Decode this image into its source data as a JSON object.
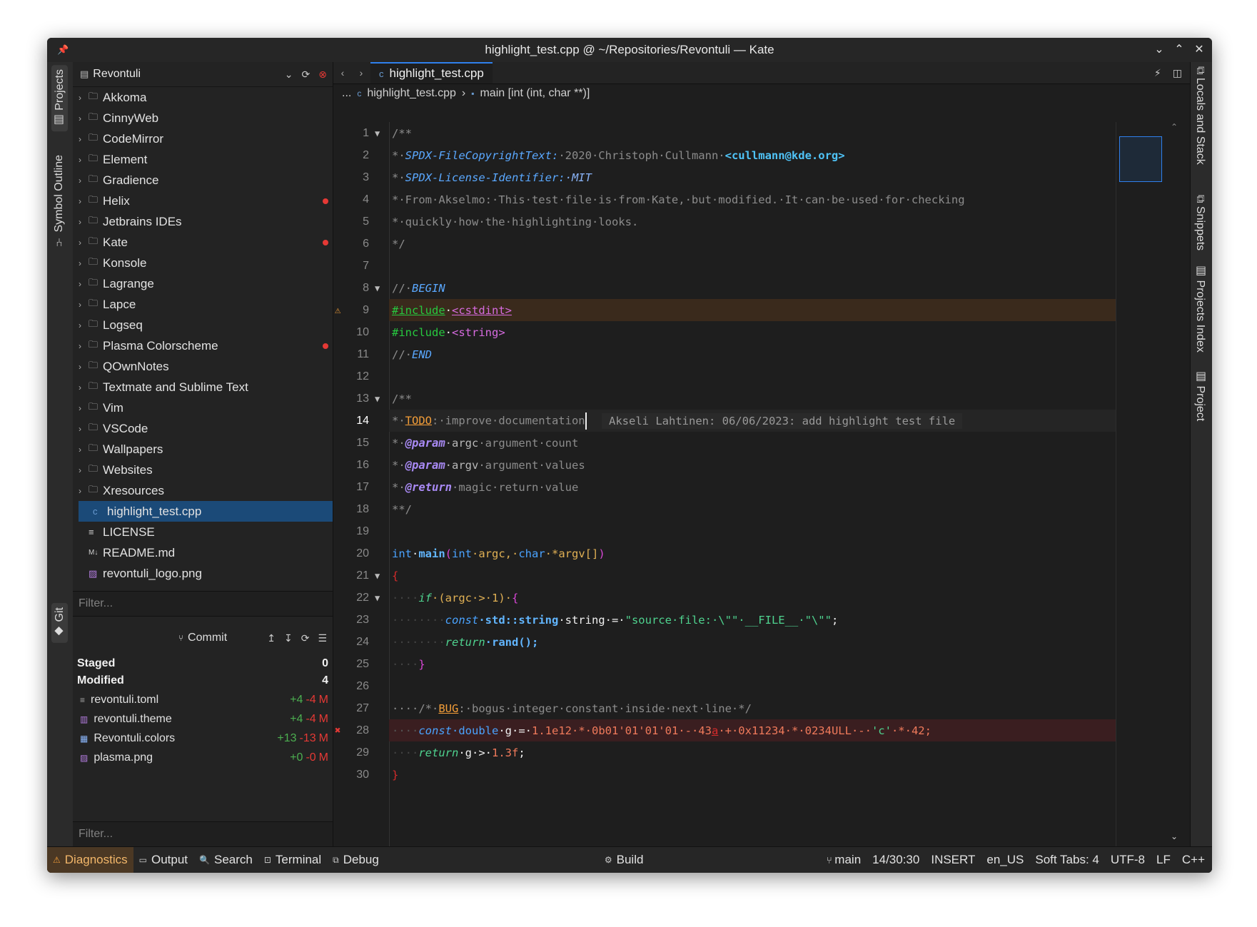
{
  "window": {
    "title": "highlight_test.cpp @ ~/Repositories/Revontuli — Kate"
  },
  "left_tabs": {
    "projects": "Projects",
    "symbol_outline": "Symbol Outline",
    "git": "Git"
  },
  "right_tabs": {
    "locals": "Locals and Stack",
    "snippets": "Snippets",
    "projects_index": "Projects Index",
    "project": "Project"
  },
  "project": {
    "name": "Revontuli",
    "folders": [
      "Akkoma",
      "CinnyWeb",
      "CodeMirror",
      "Element",
      "Gradience",
      "Helix",
      "Jetbrains IDEs",
      "Kate",
      "Konsole",
      "Lagrange",
      "Lapce",
      "Logseq",
      "Plasma Colorscheme",
      "QOwnNotes",
      "Textmate and Sublime Text",
      "Vim",
      "VSCode",
      "Wallpapers",
      "Websites",
      "Xresources"
    ],
    "files": [
      "highlight_test.cpp",
      "LICENSE",
      "README.md",
      "revontuli_logo.png"
    ],
    "filter_placeholder": "Filter..."
  },
  "git": {
    "commit_label": "Commit",
    "staged_label": "Staged",
    "staged_count": "0",
    "modified_label": "Modified",
    "modified_count": "4",
    "files": [
      {
        "name": "revontuli.toml",
        "add": "+4",
        "del": "-4",
        "status": "M"
      },
      {
        "name": "revontuli.theme",
        "add": "+4",
        "del": "-4",
        "status": "M"
      },
      {
        "name": "Revontuli.colors",
        "add": "+13",
        "del": "-13",
        "status": "M"
      },
      {
        "name": "plasma.png",
        "add": "+0",
        "del": "-0",
        "status": "M"
      }
    ],
    "filter_placeholder": "Filter..."
  },
  "editor": {
    "tab": "highlight_test.cpp",
    "breadcrumb_prefix": "...",
    "breadcrumb_file": "highlight_test.cpp",
    "breadcrumb_sep": "›",
    "breadcrumb_symbol": "main [int (int, char **)]",
    "blame": "Akseli Lahtinen: 06/06/2023: add highlight test file",
    "line_numbers": [
      "1",
      "2",
      "3",
      "4",
      "5",
      "6",
      "7",
      "8",
      "9",
      "10",
      "11",
      "12",
      "13",
      "14",
      "15",
      "16",
      "17",
      "18",
      "19",
      "20",
      "21",
      "22",
      "23",
      "24",
      "25",
      "26",
      "27",
      "28",
      "29",
      "30"
    ]
  },
  "code": {
    "l1": "/**",
    "l2a": "*·",
    "l2b": "SPDX-FileCopyrightText:",
    "l2c": "·2020·Christoph·Cullmann·",
    "l2d": "<cullmann@kde.org>",
    "l3a": "*·",
    "l3b": "SPDX-License-Identifier:",
    "l3c": "·MIT",
    "l4": "*·From·Akselmo:·This·test·file·is·from·Kate,·but·modified.·It·can·be·used·for·checking",
    "l5": "*·quickly·how·the·highlighting·looks.",
    "l6": "*/",
    "l8a": "//·",
    "l8b": "BEGIN",
    "l9a": "#include",
    "l9b": "·",
    "l9c": "<cstdint>",
    "l10a": "#include",
    "l10b": "·",
    "l10c": "<string>",
    "l11a": "//·",
    "l11b": "END",
    "l13": "/**",
    "l14a": "*·",
    "l14b": "TODO",
    "l14c": ":·improve·documentation",
    "l15a": "*·",
    "l15b": "@param",
    "l15c": "·argc",
    "l15d": "·argument·count",
    "l16a": "*·",
    "l16b": "@param",
    "l16c": "·argv",
    "l16d": "·argument·values",
    "l17a": "*·",
    "l17b": "@return",
    "l17c": "·magic·return·value",
    "l18": "**/",
    "l20a": "int",
    "l20b": "·",
    "l20c": "main",
    "l20d": "(",
    "l20e": "int",
    "l20f": "·argc,·",
    "l20g": "char",
    "l20h": "·*argv[]",
    "l20i": ")",
    "l21": "{",
    "l22a": "····",
    "l22b": "if",
    "l22c": "·(argc·>·1)·",
    "l22d": "{",
    "l23a": "········",
    "l23b": "const",
    "l23c": "·std::string",
    "l23d": "·string·=·",
    "l23e": "\"source·file:·\\\"\"·__FILE__·\"\\\"\"",
    "l23f": ";",
    "l24a": "········",
    "l24b": "return",
    "l24c": "·rand();",
    "l25a": "····",
    "l25b": "}",
    "l27a": "····/*·",
    "l27b": "BUG",
    "l27c": ":·bogus·integer·constant·inside·next·line·*/",
    "l28a": "····",
    "l28b": "const",
    "l28c": "·double",
    "l28d": "·g·=·",
    "l28e": "1.1e12·*·0b01'01'01'01·-·43",
    "l28f": "a",
    "l28g": "·+·0x11234·*·0234ULL·-·",
    "l28h": "'c'",
    "l28i": "·*·42;",
    "l29a": "····",
    "l29b": "return",
    "l29c": "·g·>·",
    "l29d": "1.3f",
    "l29e": ";",
    "l30": "}"
  },
  "statusbar": {
    "diagnostics": "Diagnostics",
    "output": "Output",
    "search": "Search",
    "terminal": "Terminal",
    "debug": "Debug",
    "build": "Build",
    "branch": "main",
    "position": "14/30:30",
    "mode": "INSERT",
    "lang": "en_US",
    "tabs": "Soft Tabs: 4",
    "encoding": "UTF-8",
    "eol": "LF",
    "syntax": "C++"
  },
  "colors": {
    "accent": "#2f80ed",
    "selection": "#1b4a78",
    "error": "#e53935",
    "warning": "#f29d38"
  }
}
